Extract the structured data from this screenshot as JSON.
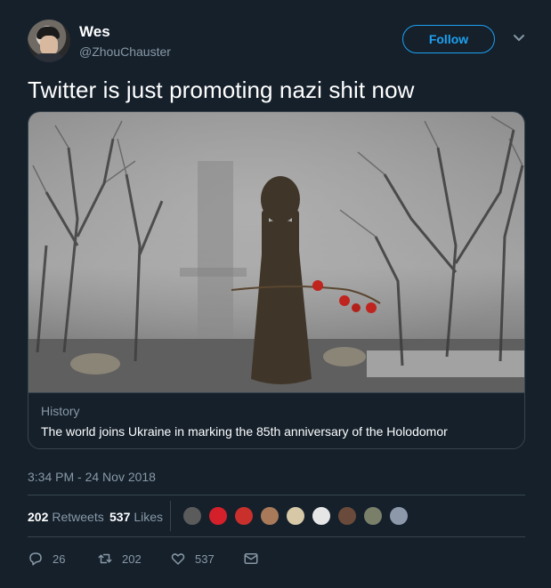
{
  "author": {
    "display_name": "Wes",
    "handle": "@ZhouChauster"
  },
  "follow_label": "Follow",
  "tweet_text": "Twitter is just promoting nazi shit now",
  "card": {
    "source": "History",
    "title": "The world joins Ukraine in marking the 85th anniversary of the Holodomor"
  },
  "timestamp": "3:34 PM - 24 Nov 2018",
  "stats": {
    "retweets_count": "202",
    "retweets_label": "Retweets",
    "likes_count": "537",
    "likes_label": "Likes"
  },
  "actions": {
    "replies": "26",
    "retweets": "202",
    "likes": "537"
  },
  "colors": {
    "background": "#15202b",
    "accent": "#1da1f2",
    "secondary_text": "#8899a6",
    "border": "#38444d"
  },
  "icons": [
    "chevron-down-icon",
    "reply-icon",
    "retweet-icon",
    "heart-icon",
    "direct-message-icon"
  ]
}
